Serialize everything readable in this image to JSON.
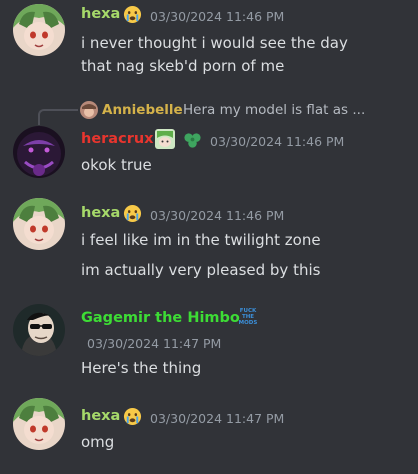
{
  "messages": [
    {
      "author": "hexa",
      "author_color": "#a6d96a",
      "timestamp": "03/30/2024 11:46 PM",
      "lines": [
        "i never thought i would see the day",
        "that nag skeb'd porn of me"
      ]
    },
    {
      "reply": {
        "author": "Anniebelle",
        "text": "Hera my model is flat as ..."
      },
      "author": "heracrux",
      "author_color": "#e8352e",
      "timestamp": "03/30/2024 11:46 PM",
      "lines": [
        "okok true"
      ]
    },
    {
      "author": "hexa",
      "author_color": "#a6d96a",
      "timestamp": "03/30/2024 11:46 PM",
      "lines": [
        "i feel like im in the twilight zone",
        "im actually very pleased by this"
      ]
    },
    {
      "author": "Gagemir the Himbo",
      "author_color": "#3ddc35",
      "badge": "FUCK THE MODS",
      "timestamp": "03/30/2024 11:47 PM",
      "lines": [
        "Here's the thing"
      ]
    },
    {
      "author": "hexa",
      "author_color": "#a6d96a",
      "timestamp": "03/30/2024 11:47 PM",
      "lines": [
        "omg"
      ]
    }
  ]
}
